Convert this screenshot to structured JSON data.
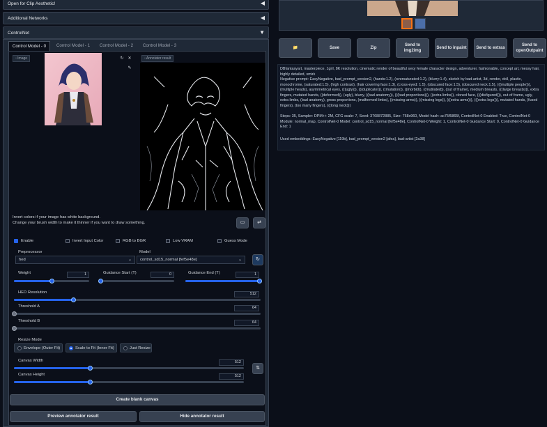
{
  "accordions": [
    {
      "label": "Open for Clip Aesthetic!",
      "arrow": "◀"
    },
    {
      "label": "Additional Networks",
      "arrow": "◀"
    },
    {
      "label": "ControlNet",
      "arrow": "▼"
    }
  ],
  "controlnet": {
    "tabs": [
      "Control Model - 0",
      "Control Model - 1",
      "Control Model - 2",
      "Control Model - 3"
    ],
    "image_label": "Image",
    "annotator_label": "Annotator result",
    "hint_line1": "Invert colors if your image has white background.",
    "hint_line2": "Change your brush width to make it thinner if you want to draw something.",
    "checkboxes": [
      {
        "label": "Enable",
        "checked": true
      },
      {
        "label": "Invert Input Color",
        "checked": false
      },
      {
        "label": "RGB to BGR",
        "checked": false
      },
      {
        "label": "Low VRAM",
        "checked": false
      },
      {
        "label": "Guess Mode",
        "checked": false
      }
    ],
    "preprocessor_label": "Preprocessor",
    "preprocessor_value": "hed",
    "model_label": "Model",
    "model_value": "control_sd15_normal [fef5e48e]",
    "weight": {
      "label": "Weight",
      "value": "1",
      "fraction": 0.5
    },
    "guidance_start": {
      "label": "Guidance Start (T)",
      "value": "0",
      "fraction": 0.0
    },
    "guidance_end": {
      "label": "Guidance End (T)",
      "value": "1",
      "fraction": 1.0
    },
    "hed_resolution": {
      "label": "HED Resolution",
      "value": "512",
      "fraction": 0.24
    },
    "threshold_a": {
      "label": "Threshold A",
      "value": "64",
      "fraction": 0.0
    },
    "threshold_b": {
      "label": "Threshold B",
      "value": "64",
      "fraction": 0.0
    },
    "resize_mode_label": "Resize Mode",
    "resize_modes": [
      {
        "label": "Envelope (Outer Fit)",
        "selected": false
      },
      {
        "label": "Scale to Fit (Inner Fit)",
        "selected": true
      },
      {
        "label": "Just Resize",
        "selected": false
      }
    ],
    "canvas_width": {
      "label": "Canvas Width",
      "value": "512",
      "fraction": 0.33
    },
    "canvas_height": {
      "label": "Canvas Height",
      "value": "512",
      "fraction": 0.33
    },
    "create_canvas_label": "Create blank canvas",
    "preview_label": "Preview annotator result",
    "hide_label": "Hide annotator result",
    "swap_icon": "⇄",
    "refresh_icon": "↻",
    "close_icon": "✕"
  },
  "right": {
    "buttons": [
      {
        "label": "📁"
      },
      {
        "label": "Save"
      },
      {
        "label": "Zip"
      },
      {
        "label": "Send to img2img"
      },
      {
        "label": "Send to inpaint"
      },
      {
        "label": "Send to extras"
      },
      {
        "label": "Send to openOutpaint"
      }
    ],
    "prompt": "DBfantasyart, masterpiece, 1girl, 8K resolution, cinematic render of beautiful sexy female character design, adventurer, fashionable, concept art, messy hair, highly detailed, smirk",
    "negative": "Negative prompt: EasyNegative, bad_prompt_version2, (hands:1.2), (oversaturated:1.2), (blurry:1.4), sketch by bad-artist, 3d, render, doll, plastic, monochrome, (saturated:1.5), (high contrast), (hair covering face:1.3), (cross-eyed: 1.5), (obscured face:1.5), (obscured neck:1.5), (((multiple people))), (multiple heads), asymmetrical eyes, (((ugly))), (((duplicate))), ((mutation)), ((morbid)), ((mutilated)), (out of frame), medium breasts, (((large breasts))), extra fingers, mutated hands, ((deformed)), (ugly), blurry, ((bad anatomy)), (((bad proportions))), ((extra limbs)), cloned face, (((disfigured))), out of frame, ugly, extra limbs, (bad anatomy), gross proportions, (malformed limbs), ((missing arms)), ((missing legs)), (((extra arms))), (((extra legs))), mutated hands, (fused fingers), (too many fingers), (((long neck)))",
    "steps": "Steps: 35, Sampler: DPM++ 2M, CFG scale: 7, Seed: 3768872885, Size: 768x960, Model hash: ac75f5865f, ControlNet-0 Enabled: True, ControlNet-0 Module: normal_map, ControlNet-0 Model: control_sd15_normal [fef5e48e], ControlNet-0 Weight: 1, ControlNet-0 Guidance Start: 0, ControlNet-0 Guidance End: 1",
    "embeddings": "Used embeddings: EasyNegative [119b], bad_prompt_version2 [afea], bad-artist [2a38]"
  }
}
